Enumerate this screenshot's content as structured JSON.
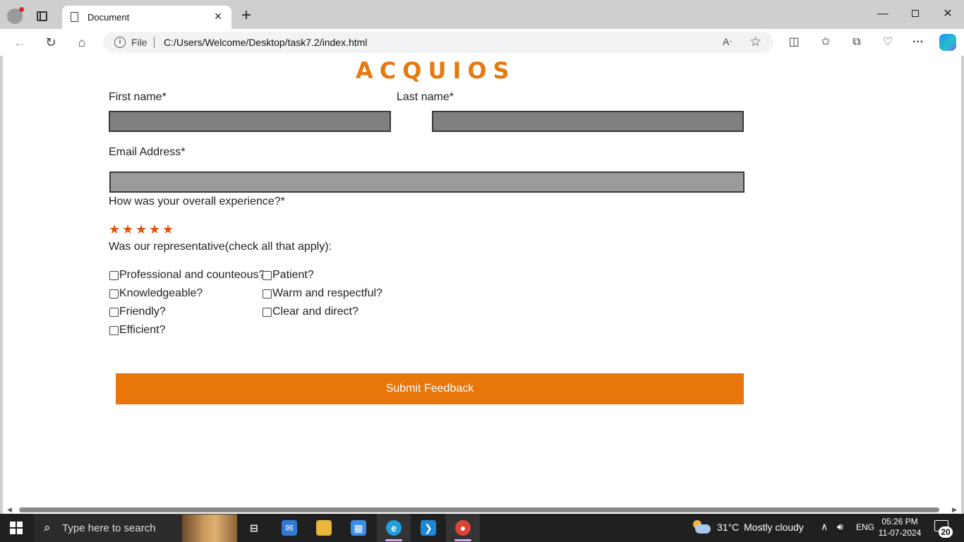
{
  "browser": {
    "tab_title": "Document",
    "file_label": "File",
    "url": "C:/Users/Welcome/Desktop/task7.2/index.html"
  },
  "page": {
    "brand": "ACQUIOS",
    "first_name_label": "First name*",
    "last_name_label": "Last name*",
    "email_label": "Email Address*",
    "experience_label": "How was your overall experience?*",
    "rating": {
      "value": 5,
      "max": 5,
      "color": "#e0510c"
    },
    "representative_label": "Was our representative(check all that apply):",
    "checkboxes": [
      {
        "label": "Professional and counteous?",
        "checked": false
      },
      {
        "label": "Patient?",
        "checked": false
      },
      {
        "label": "Knowledgeable?",
        "checked": false
      },
      {
        "label": "Warm and respectful?",
        "checked": false
      },
      {
        "label": "Friendly?",
        "checked": false
      },
      {
        "label": "Clear and direct?",
        "checked": false
      },
      {
        "label": "Efficient?",
        "checked": false
      }
    ],
    "submit_label": "Submit Feedback",
    "accent_color": "#e8760b"
  },
  "taskbar": {
    "search_placeholder": "Type here to search",
    "weather_temp": "31°C",
    "weather_desc": "Mostly cloudy",
    "language": "ENG",
    "time": "05:26 PM",
    "date": "11-07-2024",
    "notification_count": "20"
  }
}
